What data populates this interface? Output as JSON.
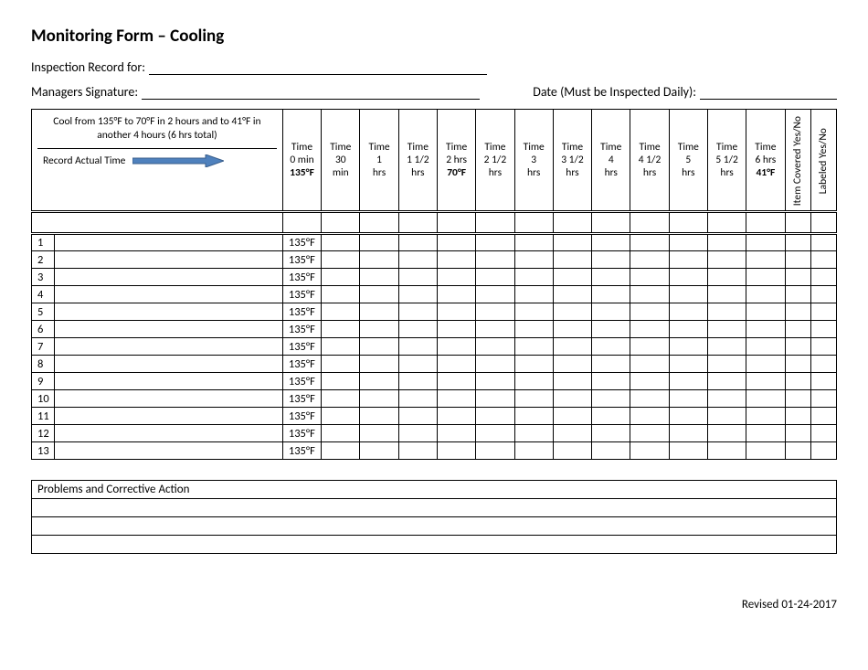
{
  "title": "Monitoring Form – Cooling",
  "fields": {
    "inspection_label": "Inspection Record for:",
    "signature_label": "Managers Signature:",
    "date_label": "Date (Must be Inspected Daily):"
  },
  "table": {
    "instruction": "Cool from 135°F to 70°F in 2 hours and to 41°F in another 4 hours (6 hrs total)",
    "record_actual_label": "Record Actual Time",
    "columns": [
      {
        "l1": "Time",
        "l2": "0 min",
        "l3": "135°F",
        "l3_bold": true
      },
      {
        "l1": "Time",
        "l2": "30",
        "l3": "min"
      },
      {
        "l1": "Time",
        "l2": "1",
        "l3": "hrs"
      },
      {
        "l1": "Time",
        "l2": "1 1/2",
        "l3": "hrs"
      },
      {
        "l1": "Time",
        "l2": "2 hrs",
        "l3": "70°F",
        "l3_bold": true
      },
      {
        "l1": "Time",
        "l2": "2 1/2",
        "l3": "hrs"
      },
      {
        "l1": "Time",
        "l2": "3",
        "l3": "hrs"
      },
      {
        "l1": "Time",
        "l2": "3 1/2",
        "l3": "hrs"
      },
      {
        "l1": "Time",
        "l2": "4",
        "l3": "hrs"
      },
      {
        "l1": "Time",
        "l2": "4 1/2",
        "l3": "hrs"
      },
      {
        "l1": "Time",
        "l2": "5",
        "l3": "hrs"
      },
      {
        "l1": "Time",
        "l2": "5 1/2",
        "l3": "hrs"
      },
      {
        "l1": "Time",
        "l2": "6 hrs",
        "l3": "41°F",
        "l3_bold": true
      }
    ],
    "vert1": "Item Covered Yes/No",
    "vert2": "Labeled Yes/No",
    "rows": [
      {
        "n": "1",
        "t": "135°F"
      },
      {
        "n": "2",
        "t": "135°F"
      },
      {
        "n": "3",
        "t": "135°F"
      },
      {
        "n": "4",
        "t": "135°F"
      },
      {
        "n": "5",
        "t": "135°F"
      },
      {
        "n": "6",
        "t": "135°F"
      },
      {
        "n": "7",
        "t": "135°F"
      },
      {
        "n": "8",
        "t": "135°F"
      },
      {
        "n": "9",
        "t": "135°F"
      },
      {
        "n": "10",
        "t": "135°F"
      },
      {
        "n": "11",
        "t": "135°F"
      },
      {
        "n": "12",
        "t": "135°F"
      },
      {
        "n": "13",
        "t": "135°F"
      }
    ]
  },
  "problems_label": "Problems and Corrective Action",
  "footer": "Revised 01-24-2017",
  "colors": {
    "arrow_fill": "#4f81bd",
    "arrow_stroke": "#385d8a"
  }
}
